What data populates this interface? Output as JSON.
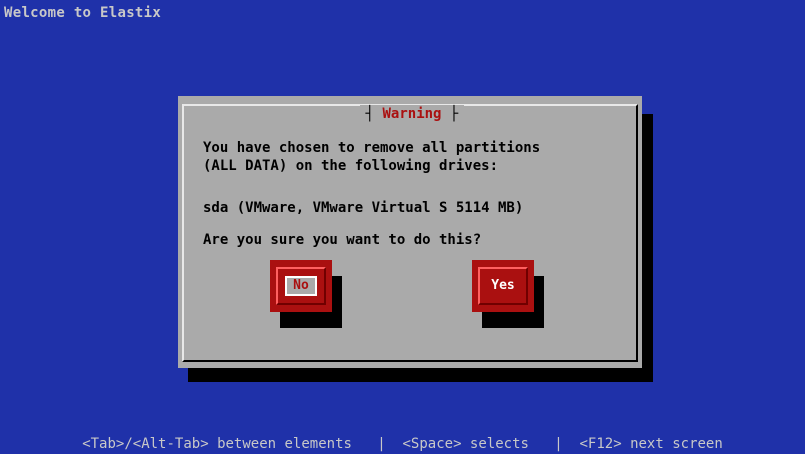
{
  "screen": {
    "title": "Welcome to Elastix"
  },
  "dialog": {
    "title": "Warning",
    "message_line1": "You have chosen to remove all partitions",
    "message_line2": "(ALL DATA) on the following drives:",
    "drive_line": "sda (VMware, VMware Virtual S 5114 MB)",
    "question": "Are you sure you want to do this?",
    "buttons": {
      "no_label": "No",
      "yes_label": "Yes"
    },
    "focused_button": "No"
  },
  "status_bar": {
    "text": "<Tab>/<Alt-Tab> between elements   |  <Space> selects   |  <F12> next screen"
  },
  "colors": {
    "background": "#1f31a9",
    "dialog": "#aaaaaa",
    "accent": "#aa1010"
  }
}
